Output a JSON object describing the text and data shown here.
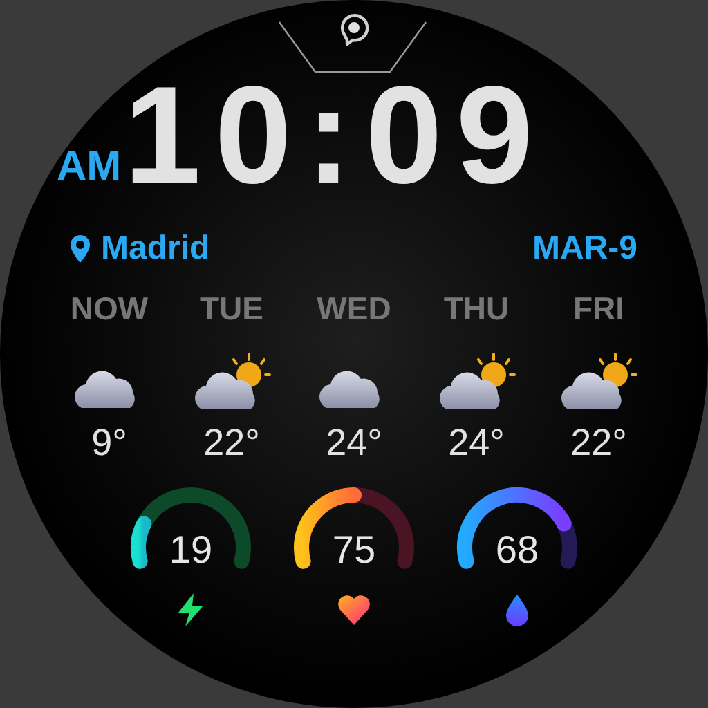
{
  "time": {
    "period": "AM",
    "clock": "10:09"
  },
  "location": "Madrid",
  "date": "MAR-9",
  "forecast": [
    {
      "day": "NOW",
      "kind": "cloudy",
      "temp": "9°"
    },
    {
      "day": "TUE",
      "kind": "partly-cloudy",
      "temp": "22°"
    },
    {
      "day": "WED",
      "kind": "cloudy",
      "temp": "24°"
    },
    {
      "day": "THU",
      "kind": "partly-cloudy",
      "temp": "24°"
    },
    {
      "day": "FRI",
      "kind": "partly-cloudy",
      "temp": "22°"
    }
  ],
  "gauges": [
    {
      "kind": "energy",
      "value": "19"
    },
    {
      "kind": "heart",
      "value": "75"
    },
    {
      "kind": "humidity",
      "value": "68"
    }
  ]
}
